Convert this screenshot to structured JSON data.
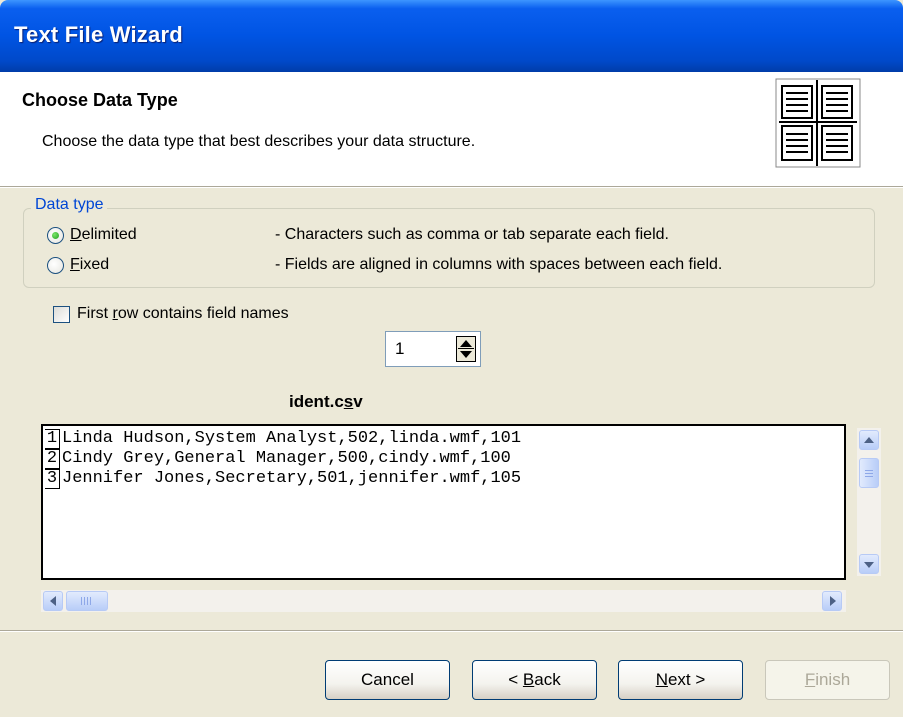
{
  "window": {
    "title": "Text File Wizard"
  },
  "header": {
    "title": "Choose Data Type",
    "subtitle": "Choose the data type that best describes your data structure."
  },
  "data_type": {
    "legend": "Data type",
    "options": [
      {
        "mnemonic": "D",
        "rest": "elimited",
        "description": "- Characters such as comma or tab separate each field.",
        "selected": true
      },
      {
        "mnemonic": "F",
        "rest": "ixed",
        "description": "- Fields are aligned in columns with spaces between each field.",
        "selected": false
      }
    ]
  },
  "first_row": {
    "pre": "First ",
    "mnemonic": "r",
    "post": "ow contains field names",
    "checked": false
  },
  "start_row": {
    "value": "1"
  },
  "file": {
    "pre": "ident.c",
    "mnemonic": "s",
    "post": "v"
  },
  "preview_rows": [
    {
      "num": "1",
      "text": "Linda Hudson,System Analyst,502,linda.wmf,101"
    },
    {
      "num": "2",
      "text": "Cindy Grey,General Manager,500,cindy.wmf,100"
    },
    {
      "num": "3",
      "text": "Jennifer Jones,Secretary,501,jennifer.wmf,105"
    }
  ],
  "buttons": {
    "cancel": "Cancel",
    "back_pre": "< ",
    "back_mnemonic": "B",
    "back_post": "ack",
    "next_mnemonic": "N",
    "next_post": "ext >",
    "finish_mnemonic": "F",
    "finish_post": "inish"
  },
  "icons": {
    "wizard": "table-columns-icon",
    "scroll_up": "arrow-up-icon",
    "scroll_down": "arrow-down-icon",
    "scroll_left": "arrow-left-icon",
    "scroll_right": "arrow-right-icon",
    "spin": "spin-updown-icon"
  },
  "colors": {
    "title_bar": "#0054E3",
    "legend": "#0046D5",
    "radio_dot": "#21A121",
    "dialog_bg": "#ECE9D8"
  }
}
